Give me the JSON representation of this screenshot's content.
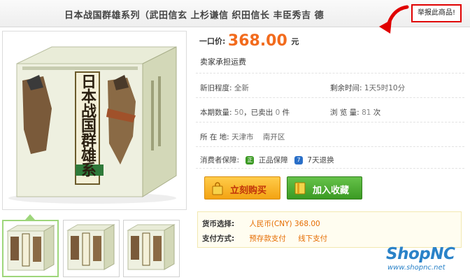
{
  "header": {
    "title": "日本战国群雄系列（武田信玄  上杉谦信  织田信长  丰臣秀吉  德",
    "report_button": "举报此商品!"
  },
  "product": {
    "box_title": "日本战国群雄系列",
    "price_label": "一口价:",
    "price_value": "368.00",
    "price_unit": "元",
    "shipping": "卖家承担运费"
  },
  "details": {
    "condition_label": "新旧程度:",
    "condition_value": "全新",
    "time_label": "剩余时间:",
    "time_value": "1天5时10分",
    "quantity_label": "本期数量:",
    "quantity_value": "50",
    "sold_label": "，已卖出",
    "sold_value": "0",
    "sold_unit": "件",
    "views_label": "浏 览 量:",
    "views_value": "81",
    "views_unit": "次",
    "location_label": "所 在 地:",
    "location_city": "天津市",
    "location_district": "南开区"
  },
  "guarantee": {
    "label": "消费者保障:",
    "item1": "正品保障",
    "item2": "7天退换",
    "icon1_text": "正",
    "icon2_text": "7"
  },
  "buttons": {
    "buy_now": "立刻购买",
    "add_favorite": "加入收藏"
  },
  "payment": {
    "currency_label": "货币选择:",
    "currency_value": "人民币(CNY) 368.00",
    "method_label": "支付方式:",
    "method1": "预存款支付",
    "method2": "线下支付"
  },
  "brand": {
    "name": "ShopNC",
    "url": "www.shopnc.net"
  },
  "colors": {
    "price": "#f26b1d",
    "report_border": "#e00000",
    "buy_button": "#f3a313",
    "favorite_button": "#3b9a23",
    "brand": "#2a82c8",
    "thumb_active": "#9ed67b"
  }
}
